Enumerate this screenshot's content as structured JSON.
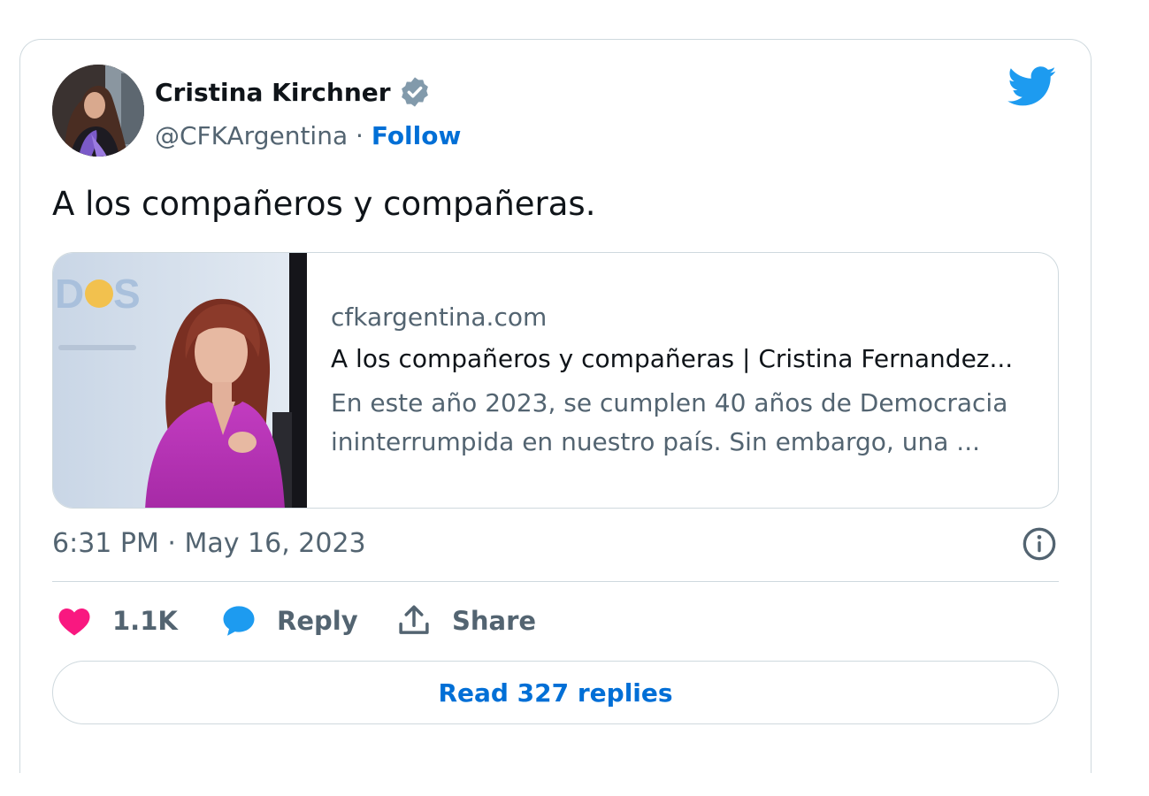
{
  "author": {
    "name": "Cristina Kirchner",
    "handle": "@CFKArgentina",
    "separator": "·",
    "follow_label": "Follow",
    "verified_icon": "verified-badge-icon",
    "avatar": "profile-photo"
  },
  "brand": {
    "icon": "twitter-bird-icon",
    "color": "#1d9bf0"
  },
  "tweet": {
    "text": "A los compañeros y compañeras."
  },
  "link_card": {
    "domain": "cfkargentina.com",
    "title": "A los compañeros y compañeras | Cristina Fernandez...",
    "description": "En este año 2023, se cumplen 40 años de Democracia ininterrumpida en nuestro país. Sin embargo, una ...",
    "image": "photo-woman-in-magenta-blouse"
  },
  "meta": {
    "timestamp": "6:31 PM · May 16, 2023",
    "info_icon": "info-icon"
  },
  "actions": {
    "like_count": "1.1K",
    "like_icon": "heart-icon",
    "like_color": "#f91880",
    "reply_label": "Reply",
    "reply_icon": "speech-bubble-icon",
    "reply_color": "#1d9bf0",
    "share_label": "Share",
    "share_icon": "share-upload-icon"
  },
  "read_replies_label": "Read 327 replies",
  "colors": {
    "link": "#006fd6",
    "text_primary": "#0f1419",
    "text_secondary": "#536471",
    "border": "#cfd9de"
  }
}
